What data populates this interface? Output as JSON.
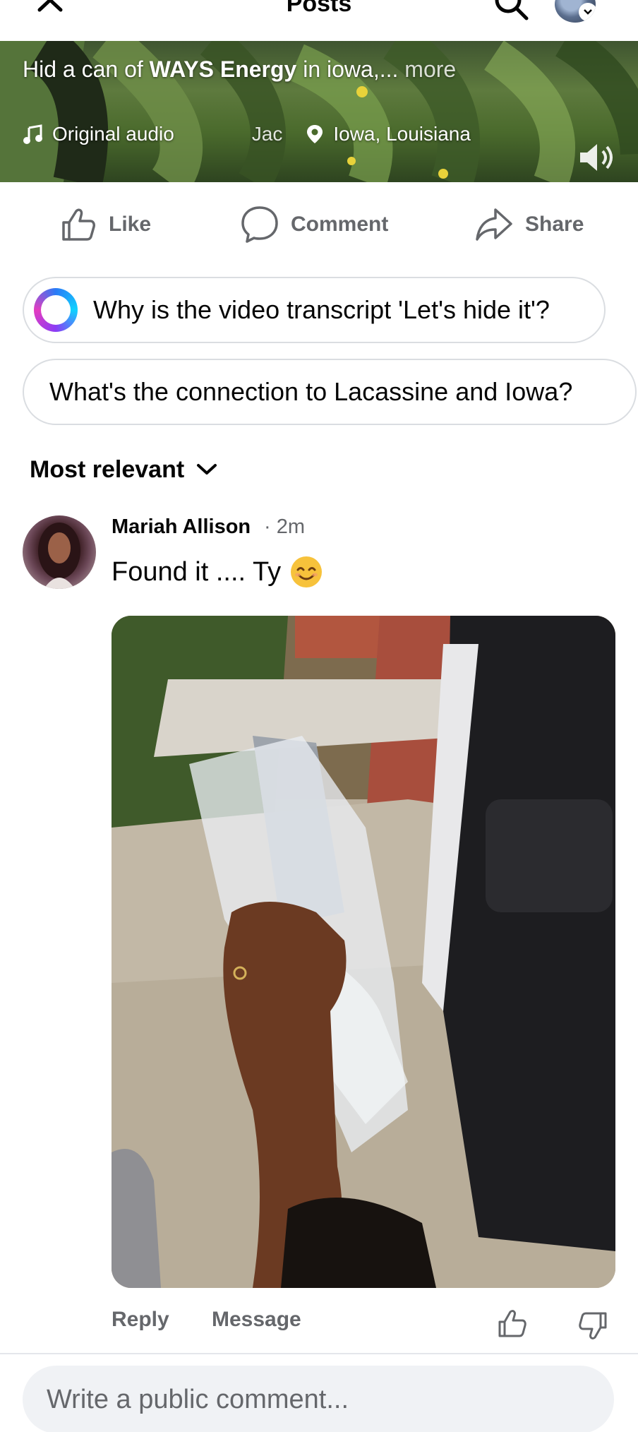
{
  "header": {
    "title": "Posts",
    "icons": {
      "close": "close-icon",
      "search": "search-icon",
      "profile": "profile-avatar-icon"
    }
  },
  "video": {
    "caption_prefix": "Hid a can of ",
    "caption_brand": "WAYS Energy",
    "caption_suffix": "  in iowa,... ",
    "caption_more": "more",
    "audio_label": "Original audio",
    "author_fragment": "Jac",
    "location": "Iowa, Louisiana",
    "icons": {
      "audio": "music-note-icon",
      "location": "location-pin-icon",
      "volume": "speaker-icon"
    }
  },
  "actions": {
    "like": "Like",
    "comment": "Comment",
    "share": "Share"
  },
  "suggestions": [
    {
      "text": "Why is the video transcript 'Let's hide it'?",
      "icon": "meta-ai-icon"
    },
    {
      "text": "What's the connection to Lacassine and Iowa?"
    }
  ],
  "sort": {
    "label": "Most relevant"
  },
  "comment": {
    "author": "Mariah Allison",
    "time": " · 2m",
    "text": "Found it .... Ty",
    "emoji": "smiling-face-emoji",
    "reply": "Reply",
    "message": "Message"
  },
  "composer": {
    "placeholder": "Write a public comment..."
  },
  "colors": {
    "secondary_text": "#65676b",
    "chip_border": "#dadde1",
    "composer_bg": "#f0f2f5"
  }
}
